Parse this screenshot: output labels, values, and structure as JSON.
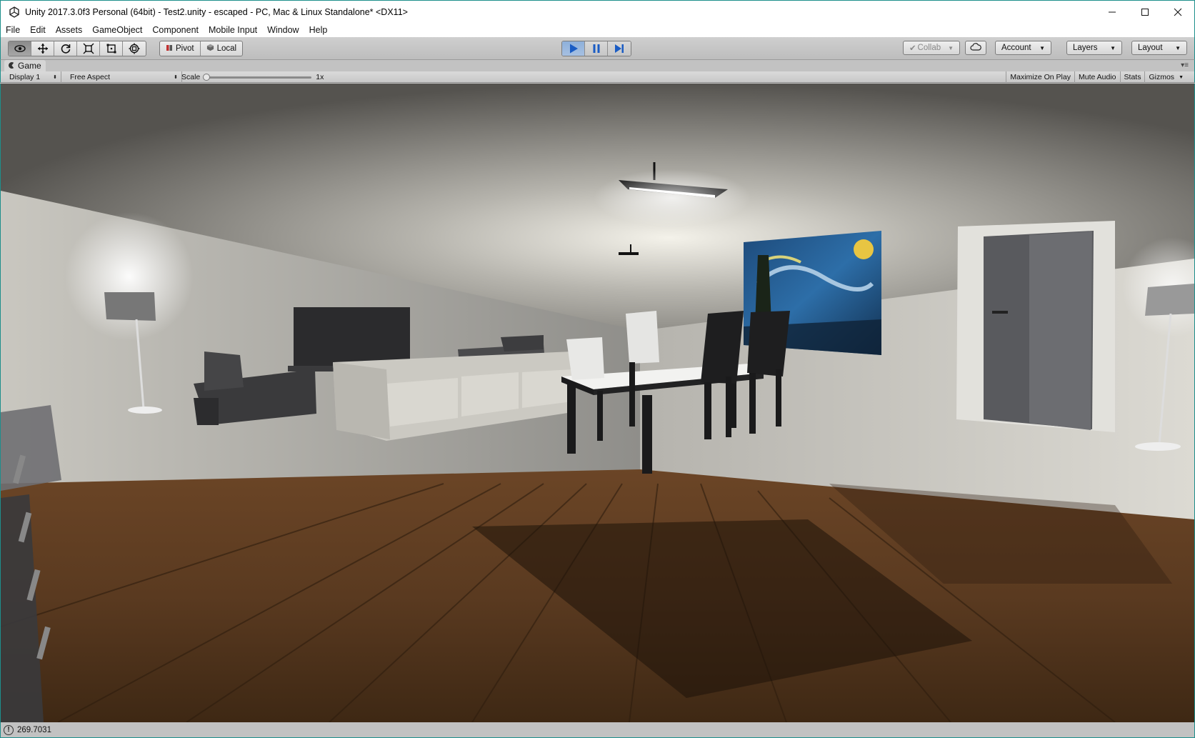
{
  "window": {
    "title": "Unity 2017.3.0f3 Personal (64bit) - Test2.unity - escaped - PC, Mac & Linux Standalone* <DX11>",
    "controls": [
      "minimize-icon",
      "maximize-icon",
      "close-icon"
    ]
  },
  "menu": [
    "File",
    "Edit",
    "Assets",
    "GameObject",
    "Component",
    "Mobile Input",
    "Window",
    "Help"
  ],
  "toolbar": {
    "transform_tools": [
      "hand-eye-icon",
      "move-icon",
      "rotate-icon",
      "scale-icon",
      "rect-icon",
      "transform-icon"
    ],
    "pivot_label": "Pivot",
    "local_label": "Local",
    "play_controls": [
      "play-icon",
      "pause-icon",
      "step-icon"
    ],
    "collab_label": "Collab",
    "account_label": "Account",
    "layers_label": "Layers",
    "layout_label": "Layout"
  },
  "game_view": {
    "tab_label": "Game",
    "display_label": "Display 1",
    "aspect_label": "Free Aspect",
    "scale_label": "Scale",
    "scale_value": "1x",
    "buttons": {
      "maximize_on_play": "Maximize On Play",
      "mute_audio": "Mute Audio",
      "stats": "Stats",
      "gizmos": "Gizmos"
    }
  },
  "status": {
    "icon": "info-icon",
    "text": "269.7031"
  },
  "colors": {
    "accent_border": "#1d8f8c",
    "play_active": "#8eb0da",
    "chrome": "#c2c2c2"
  }
}
